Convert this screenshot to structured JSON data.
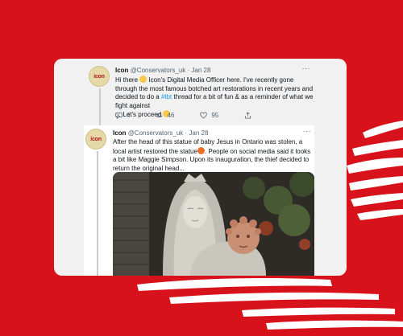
{
  "colors": {
    "background": "#d8121b",
    "card": "#f1f1f1",
    "hashtag": "#1d9bf0"
  },
  "tweets": [
    {
      "avatar_text": "icon",
      "name": "Icon",
      "handle": "@Conservators_uk",
      "separator": "·",
      "date": "Jan 28",
      "more": "···",
      "text_parts": {
        "t1": "Hi there ",
        "t2": " Icon's Digital Media Officer here. I've recently gone through the most famous botched art restorations in recent years and decided to do a ",
        "hashtag": "#tbt",
        "t3": " thread for a bit of fun & as a reminder of what we fight against",
        "tools": "⚔",
        "t4": " Let's proceed "
      },
      "actions": {
        "replies": "4",
        "retweets": "46",
        "likes": "95"
      }
    },
    {
      "avatar_text": "icon",
      "name": "Icon",
      "handle": "@Conservators_uk",
      "separator": "·",
      "date": "Jan 28",
      "more": "···",
      "text_parts": {
        "t1": "After the head of this statue of baby Jesus in Ontario was stolen, a local artist restored the statue",
        "t2": ". People on social media said it looks a bit like Maggie Simpson. Upon its inauguration, the thief decided to return the original head..."
      }
    }
  ]
}
